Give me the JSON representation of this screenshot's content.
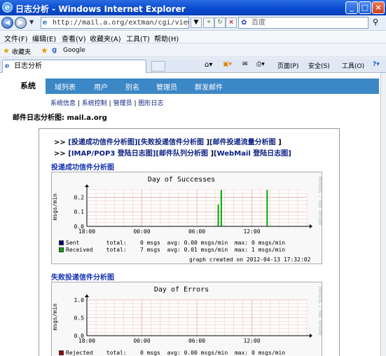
{
  "window": {
    "title": "日志分析 - Windows Internet Explorer"
  },
  "address": {
    "url": "http://mail.a.org/extman/cgi/viewlog.cgi?...",
    "search_placeholder": "百度"
  },
  "menu": [
    "文件(F)",
    "编辑(E)",
    "查看(V)",
    "收藏夹(A)",
    "工具(T)",
    "帮助(H)"
  ],
  "favorites": {
    "label": "收藏夹",
    "items": [
      "Google"
    ]
  },
  "tab": {
    "title": "日志分析"
  },
  "toolbar": [
    "页面(P)",
    "安全(S)",
    "工具(O)"
  ],
  "nav": {
    "items": [
      "系统",
      "域列表",
      "用户",
      "别名",
      "管理员",
      "群发邮件"
    ],
    "active": "系统"
  },
  "sublinks": [
    "系统信息",
    "系统控制",
    "管理员",
    "图形日志"
  ],
  "heading": "邮件日志分析图: mail.a.org",
  "report_links": {
    "row1": [
      ">>",
      "[投递成功信件分析图]",
      "[失败投递信件分析图",
      "]",
      "[邮件投递流量分析图",
      "]"
    ],
    "row2": [
      ">>",
      "[IMAP/POP3 登陆日志图]",
      "[邮件队列分析图",
      "]",
      "[WebMail 登陆日志图]"
    ]
  },
  "sections": [
    {
      "title": "投递成功信件分析图",
      "graph_title": "Day of Successes",
      "ylabel": "msgs/min",
      "side": "PROTOCOL / TOBI OETIKER",
      "chart_data": {
        "type": "line",
        "x_ticks": [
          "18:00",
          "00:00",
          "06:00",
          "12:00"
        ],
        "y_ticks": [
          "0.0",
          "0.1",
          "0.2"
        ],
        "ylim": [
          0,
          0.25
        ],
        "series": [
          {
            "name": "Sent",
            "color": "#000080",
            "values": []
          },
          {
            "name": "Received",
            "color": "#00aa00",
            "spikes": [
              {
                "x": "08:20",
                "y": 0.15
              },
              {
                "x": "08:40",
                "y": 0.25
              },
              {
                "x": "13:40",
                "y": 0.25
              }
            ]
          }
        ]
      },
      "legend": [
        {
          "name": "Sent",
          "color": "#000080",
          "total": "total:",
          "val": "0 msgs",
          "avg": "avg: 0.00 msgs/min",
          "max": "max: 0 msgs/min"
        },
        {
          "name": "Received",
          "color": "#00aa00",
          "total": "total:",
          "val": "7 msgs",
          "avg": "avg: 0.01 msgs/min",
          "max": "max: 1 msgs/min"
        }
      ],
      "footer": "graph created on 2012-04-13 17:32:02"
    },
    {
      "title": "失败投递信件分析图",
      "graph_title": "Day of Errors",
      "ylabel": "msgs/min",
      "side": "PROTOCOL / TOBI OETIKER",
      "chart_data": {
        "type": "line",
        "x_ticks": [
          "18:00",
          "00:00",
          "06:00",
          "12:00"
        ],
        "y_ticks": [
          "0.0",
          "0.5",
          "1.0"
        ],
        "ylim": [
          0,
          1.0
        ],
        "series": [
          {
            "name": "Rejected",
            "color": "#aa0000",
            "values": []
          }
        ]
      },
      "legend": [
        {
          "name": "Rejected",
          "color": "#aa0000",
          "total": "total:",
          "val": "0 msgs",
          "avg": "avg: 0.00 msgs/min",
          "max": "max: 0 msgs/min"
        }
      ]
    }
  ]
}
